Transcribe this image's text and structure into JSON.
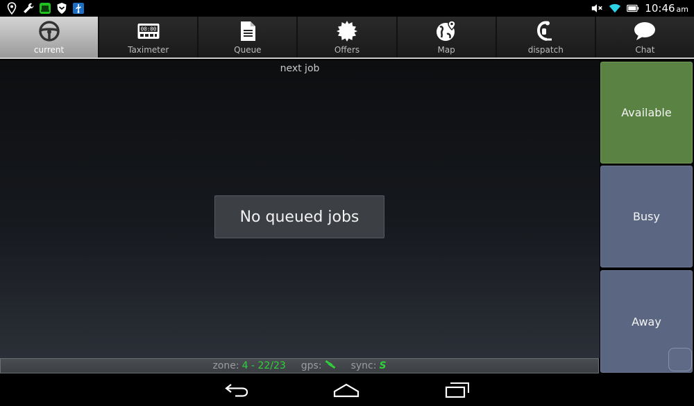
{
  "statusbar": {
    "left_icons": [
      "location-pin-icon",
      "wrench-icon",
      "taxi-app-icon",
      "shield-icon",
      "usb-icon"
    ],
    "right_icons": [
      "mute-icon",
      "wifi-icon",
      "battery-icon"
    ],
    "time": "10:46",
    "ampm": "am"
  },
  "tabs": [
    {
      "label": "current",
      "icon": "steering-wheel-icon",
      "active": true
    },
    {
      "label": "Taximeter",
      "icon": "taximeter-icon",
      "meter_text": "00:00",
      "active": false
    },
    {
      "label": "Queue",
      "icon": "document-icon",
      "active": false
    },
    {
      "label": "Offers",
      "icon": "starburst-icon",
      "active": false
    },
    {
      "label": "Map",
      "icon": "globe-pin-icon",
      "active": false
    },
    {
      "label": "dispatch",
      "icon": "headset-icon",
      "active": false
    },
    {
      "label": "Chat",
      "icon": "chat-bubble-icon",
      "active": false
    }
  ],
  "main": {
    "next_job_label": "next job",
    "empty_message": "No queued jobs"
  },
  "footer": {
    "zone_label": "zone:",
    "zone_value": "4 - 22/23",
    "gps_label": "gps:",
    "sync_label": "sync:",
    "sync_value": "S"
  },
  "status_buttons": {
    "available": "Available",
    "busy": "Busy",
    "away": "Away"
  },
  "colors": {
    "available": "#5a8243",
    "busy_away": "#5b6782",
    "status_ok": "#2fd23a"
  },
  "navbar": [
    "back-icon",
    "home-icon",
    "recents-icon"
  ]
}
